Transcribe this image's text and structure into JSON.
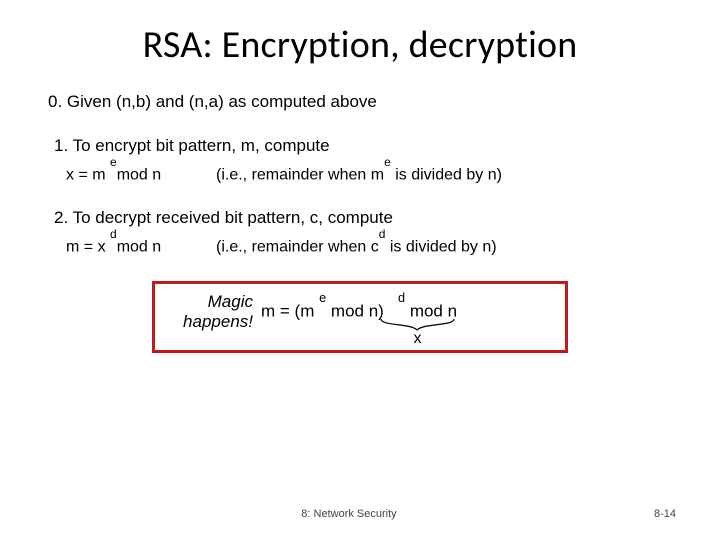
{
  "title": "RSA: Encryption, decryption",
  "step0": "0.  Given (n,b) and (n,a) as computed above",
  "step1": "1. To encrypt bit pattern, m, compute",
  "step1_formula_pre": "x = m ",
  "step1_formula_sup": "e",
  "step1_formula_post": "mod  n",
  "step1_remainder_pre": "(i.e., remainder when m",
  "step1_remainder_sup": "e",
  "step1_remainder_post": " is divided by n)",
  "step2": "2. To decrypt received bit pattern, c, compute",
  "step2_formula_pre": "m = x ",
  "step2_formula_sup": "d",
  "step2_formula_post": "mod  n",
  "step2_remainder_pre": "(i.e., remainder when c",
  "step2_remainder_sup": "d",
  "step2_remainder_post": " is divided by n)",
  "magic_label_l1": "Magic",
  "magic_label_l2": "happens!",
  "magic_formula_1": "m  =  (m ",
  "magic_formula_sup1": "e",
  "magic_formula_2": " mod  n)",
  "magic_formula_sup2": "d",
  "magic_formula_3": " mod  n",
  "brace_x": "x",
  "footer_center": "8: Network Security",
  "footer_right": "8-14"
}
